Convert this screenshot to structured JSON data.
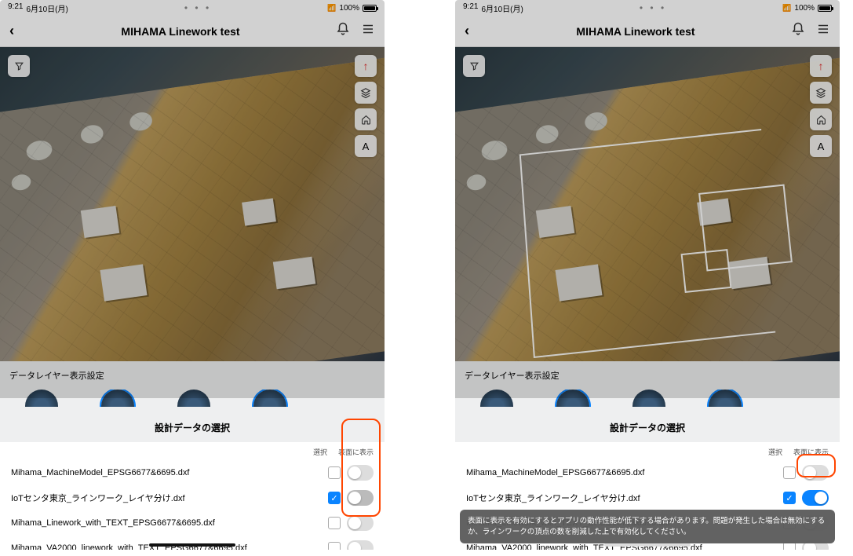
{
  "status": {
    "time": "9:21",
    "date": "6月10日(月)",
    "battery": "100%"
  },
  "title": "MIHAMA Linework test",
  "panel_label": "データレイヤー表示設定",
  "section_title": "設計データの選択",
  "columns": {
    "select": "選択",
    "display": "表面に表示"
  },
  "rows": [
    {
      "label": "Mihama_MachineModel_EPSG6677&6695.dxf",
      "checked": false,
      "toggle": "disabled"
    },
    {
      "label": "IoTセンタ東京_ラインワーク_レイヤ分け.dxf",
      "checked": true,
      "toggle": "varies"
    },
    {
      "label": "Mihama_Linework_with_TEXT_EPSG6677&6695.dxf",
      "checked": false,
      "toggle": "disabled"
    },
    {
      "label": "Mihama_VA2000_linework_with_TEXT_EPSG6677&6695.dxf",
      "checked": false,
      "toggle": "disabled"
    }
  ],
  "screens": {
    "left": {
      "row2_toggle_on": false,
      "show_linework": false,
      "show_toast": false
    },
    "right": {
      "row2_toggle_on": true,
      "show_linework": true,
      "show_toast": true
    }
  },
  "toast_message": "表面に表示を有効にするとアプリの動作性能が低下する場合があります。問題が発生した場合は無効にするか、ラインワークの頂点の数を削減した上で有効化してください。"
}
